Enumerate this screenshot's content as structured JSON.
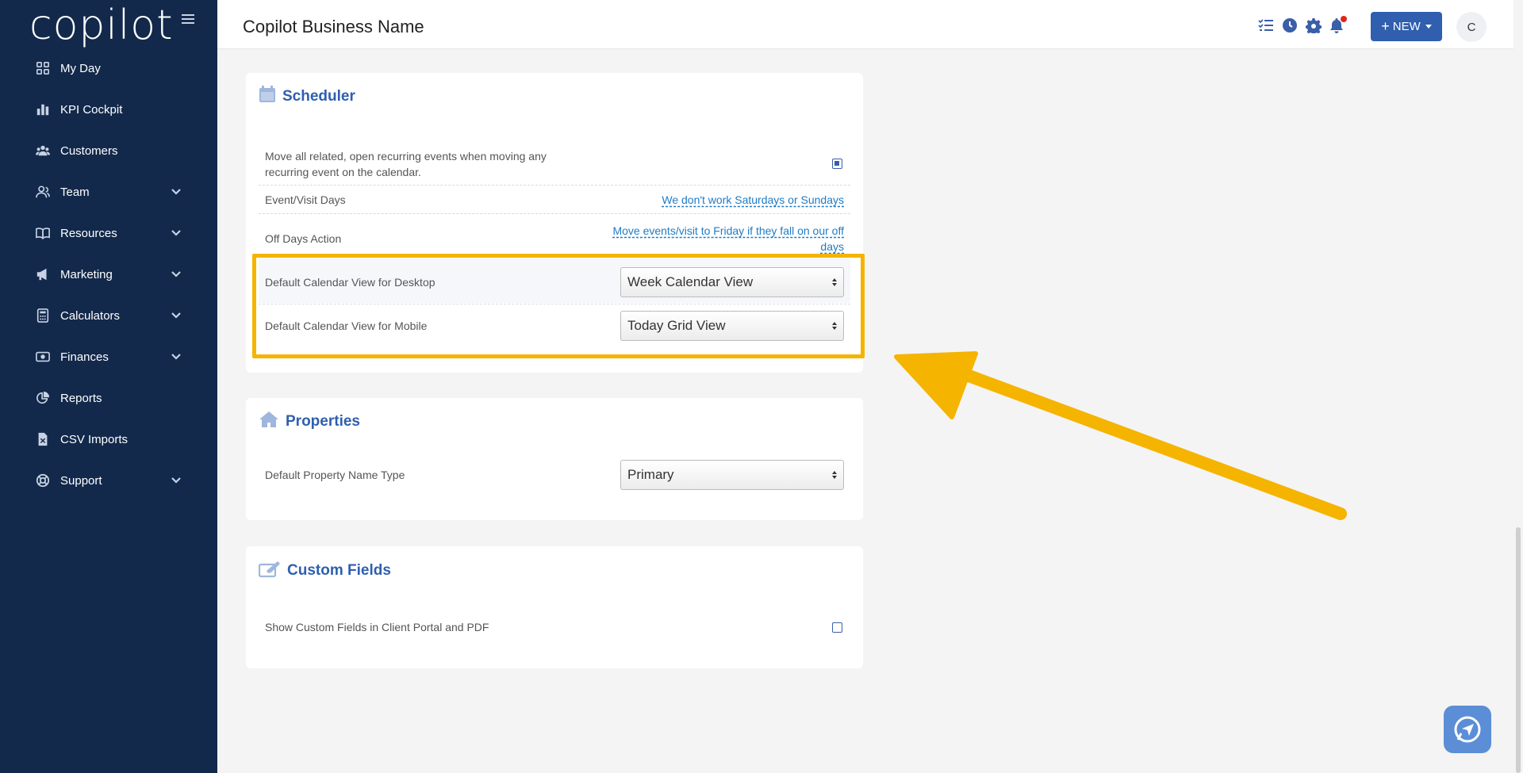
{
  "brand": {
    "logo_text": "copilot"
  },
  "sidebar": {
    "items": [
      {
        "label": "My Day",
        "icon": "grid-icon",
        "expandable": false
      },
      {
        "label": "KPI Cockpit",
        "icon": "bar-chart-icon",
        "expandable": false
      },
      {
        "label": "Customers",
        "icon": "users-icon",
        "expandable": false
      },
      {
        "label": "Team",
        "icon": "team-icon",
        "expandable": true
      },
      {
        "label": "Resources",
        "icon": "book-icon",
        "expandable": true
      },
      {
        "label": "Marketing",
        "icon": "megaphone-icon",
        "expandable": true
      },
      {
        "label": "Calculators",
        "icon": "calculator-icon",
        "expandable": true
      },
      {
        "label": "Finances",
        "icon": "money-icon",
        "expandable": true
      },
      {
        "label": "Reports",
        "icon": "pie-chart-icon",
        "expandable": false
      },
      {
        "label": "CSV Imports",
        "icon": "csv-file-icon",
        "expandable": false
      },
      {
        "label": "Support",
        "icon": "lifebuoy-icon",
        "expandable": true
      }
    ]
  },
  "header": {
    "title": "Copilot Business Name",
    "new_button": "NEW",
    "avatar_initial": "C"
  },
  "scheduler": {
    "title": "Scheduler",
    "rows": {
      "move_recurring": {
        "label": "Move all related, open recurring events when moving any recurring event on the calendar.",
        "checked": true
      },
      "visit_days": {
        "label": "Event/Visit Days",
        "value": "We don't work Saturdays or Sundays"
      },
      "off_days": {
        "label": "Off Days Action",
        "value": "Move events/visit to Friday if they fall on our off days"
      },
      "desktop_view": {
        "label": "Default Calendar View for Desktop",
        "value": "Week Calendar View"
      },
      "mobile_view": {
        "label": "Default Calendar View for Mobile",
        "value": "Today Grid View"
      }
    }
  },
  "properties": {
    "title": "Properties",
    "name_type": {
      "label": "Default Property Name Type",
      "value": "Primary"
    }
  },
  "custom_fields": {
    "title": "Custom Fields",
    "show_in_portal": {
      "label": "Show Custom Fields in Client Portal and PDF",
      "checked": false
    }
  },
  "colors": {
    "sidebar_bg": "#13294b",
    "accent": "#2f5fae",
    "highlight": "#f5b400",
    "link": "#1f7bc4"
  }
}
